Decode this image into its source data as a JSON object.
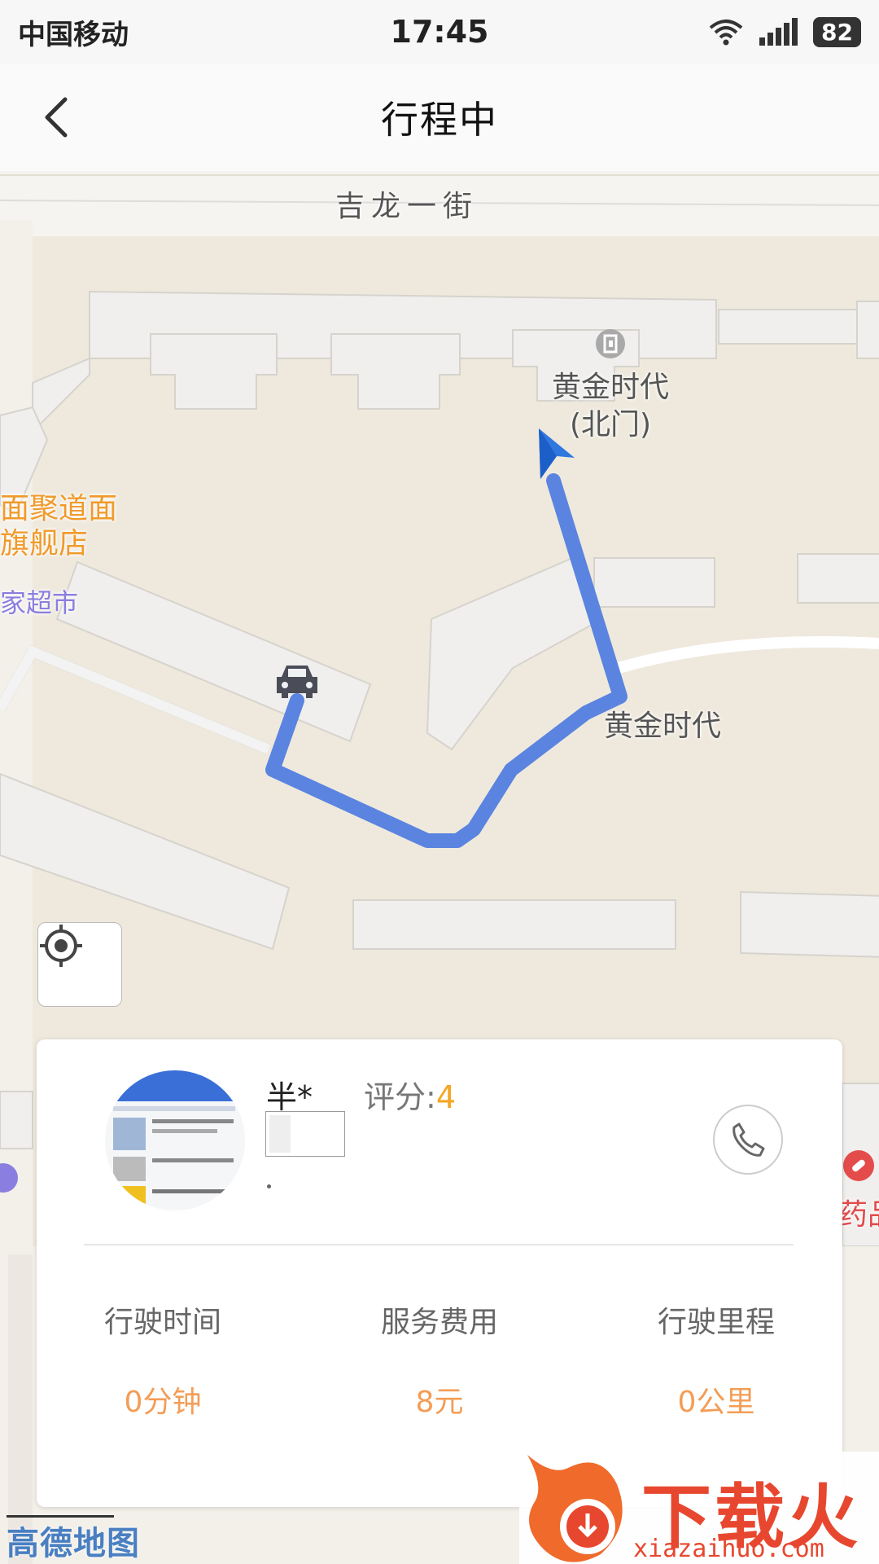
{
  "status_bar": {
    "carrier": "中国移动",
    "time": "17:45",
    "battery": "82"
  },
  "nav": {
    "title": "行程中"
  },
  "map": {
    "labels": {
      "street": "吉龙一街",
      "poi_north_gate_line1": "黄金时代",
      "poi_north_gate_line2": "(北门)",
      "restaurant_line1": "面聚道面",
      "restaurant_line2": "旗舰店",
      "supermarket": "家超市",
      "area": "黄金时代",
      "pharmacy": "药品"
    },
    "logo": "高德地图"
  },
  "driver": {
    "name": "半*",
    "rating_label": "评分:",
    "rating_value": "4"
  },
  "trip": {
    "stats": [
      {
        "label": "行驶时间",
        "value": "0分钟"
      },
      {
        "label": "服务费用",
        "value": "8元"
      },
      {
        "label": "行驶里程",
        "value": "0公里"
      }
    ]
  },
  "watermark": {
    "title": "下载火",
    "site": "xiazaihuo.com"
  },
  "colors": {
    "route": "#5a84e0",
    "accent_orange": "#f39d56",
    "rating": "#f5a623",
    "map_bg": "#efe9dd",
    "building": "#f0efed"
  }
}
